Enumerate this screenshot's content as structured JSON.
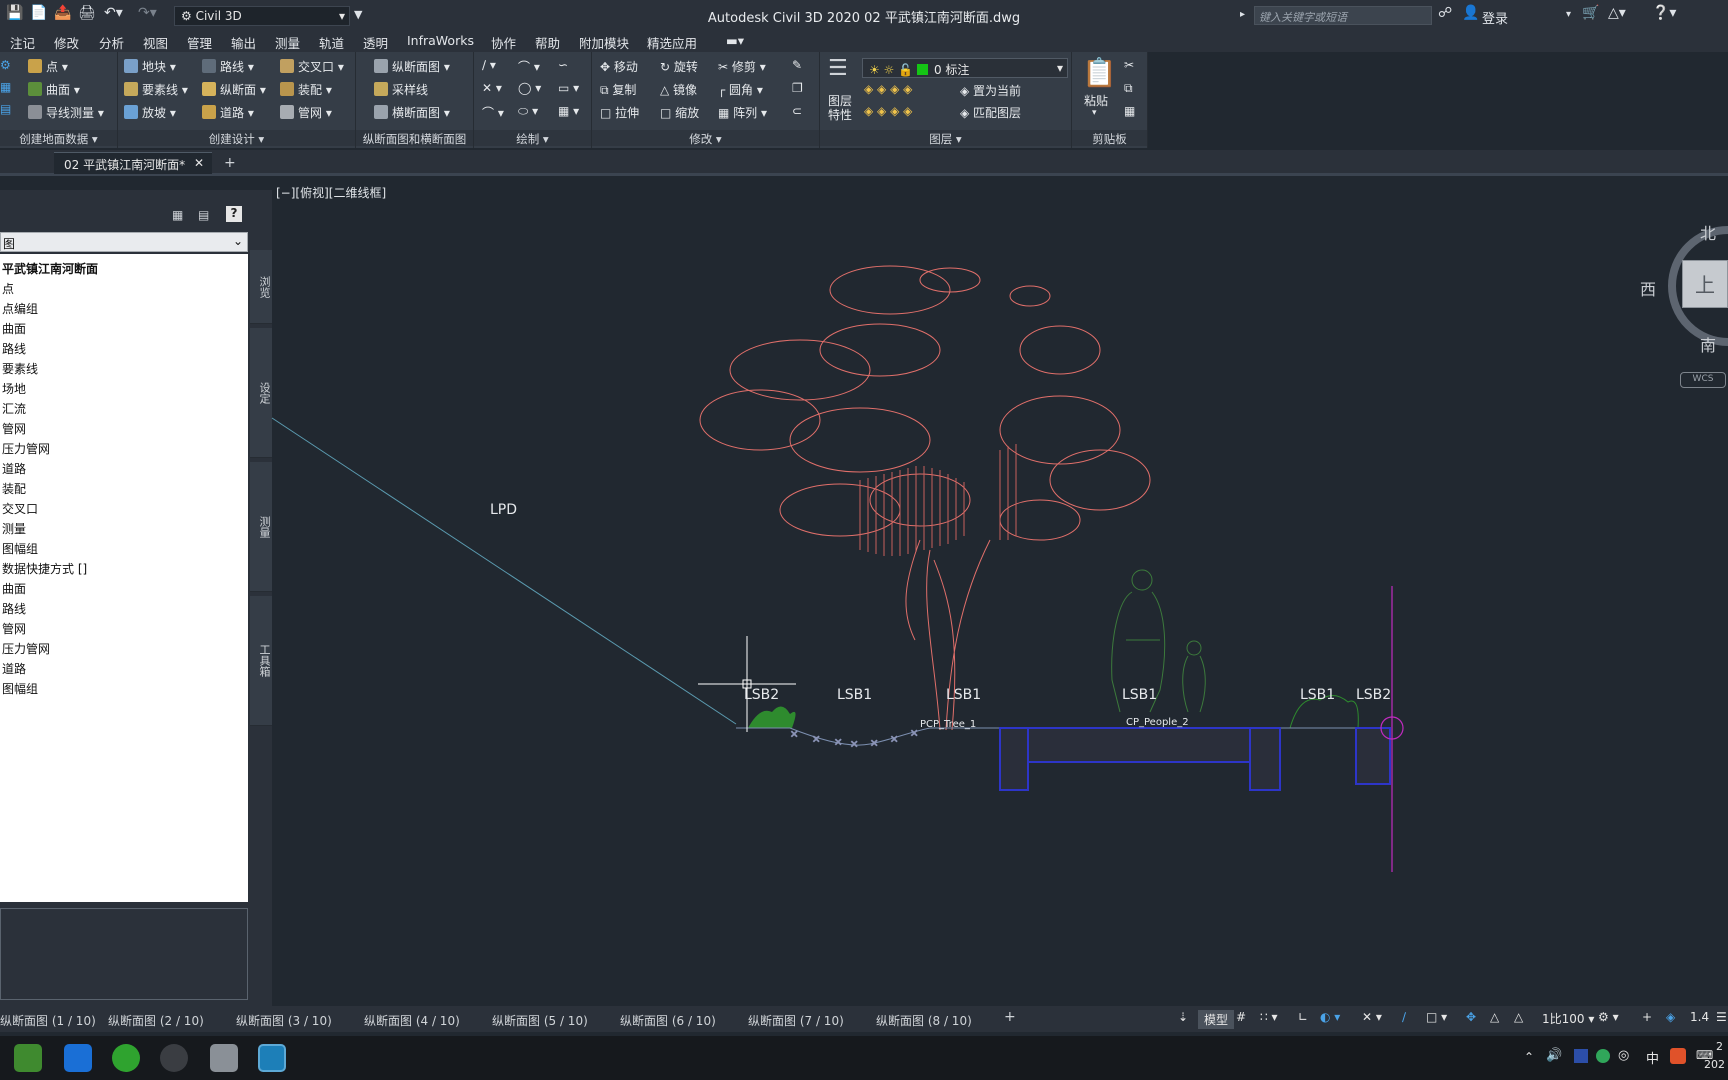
{
  "title_bar": {
    "app_title": "Autodesk Civil 3D 2020    02 平武镇江南河断面.dwg",
    "workspace": "Civil 3D",
    "search_placeholder": "键入关键字或短语",
    "login": "登录"
  },
  "menu": [
    "注记",
    "修改",
    "分析",
    "视图",
    "管理",
    "输出",
    "测量",
    "轨道",
    "透明",
    "InfraWorks",
    "协作",
    "帮助",
    "附加模块",
    "精选应用"
  ],
  "ribbon": {
    "create_ground": {
      "title": "创建地面数据",
      "buttons": [
        "点",
        "曲面",
        "导线测量"
      ]
    },
    "create_design": {
      "title": "创建设计",
      "buttons": [
        "地块",
        "要素线",
        "放坡",
        "路线",
        "纵断面",
        "道路",
        "交叉口",
        "装配",
        "管网"
      ]
    },
    "profile_section": {
      "title": "纵断面图和横断面图",
      "buttons": [
        "纵断面图",
        "采样线",
        "横断面图"
      ]
    },
    "draw": {
      "title": "绘制"
    },
    "modify": {
      "title": "修改",
      "buttons": [
        "移动",
        "旋转",
        "修剪",
        "复制",
        "镜像",
        "圆角",
        "拉伸",
        "缩放",
        "阵列"
      ]
    },
    "layers": {
      "title": "图层",
      "current_layer": "0 标注",
      "properties_label": "图层特性",
      "set_current": "置为当前",
      "match_layer": "匹配图层"
    },
    "clipboard": {
      "title": "剪贴板",
      "paste": "粘贴"
    }
  },
  "document_tab": "02 平武镇江南河断面*",
  "viewport": {
    "label": "[−][俯视][二维线框]",
    "viewcube": {
      "north": "北",
      "south": "南",
      "west": "西",
      "top": "上",
      "wcs": "WCS"
    },
    "labels": [
      "LPD",
      "LSB2",
      "LSB1",
      "LSB1",
      "LSB1",
      "LSB1",
      "LSB2"
    ],
    "small_labels": [
      "PCP_Tree_1",
      "CP_People_2"
    ],
    "colors": {
      "background": "#212830",
      "tree": "#e06f6a",
      "grass": "#2e8b2e",
      "people": "#3c7a3c",
      "slope_line": "#5b9bb0",
      "structure": "#2d35c8",
      "axis": "#c02bc0"
    }
  },
  "palette": {
    "dropdown": "图",
    "tree": [
      "平武镇江南河断面",
      "点",
      "点编组",
      "曲面",
      "路线",
      "要素线",
      "场地",
      "汇流",
      "管网",
      "压力管网",
      "道路",
      "装配",
      "交叉口",
      "测量",
      "图幅组",
      "数据快捷方式 []",
      "曲面",
      "路线",
      "管网",
      "压力管网",
      "道路",
      "图幅组"
    ],
    "vertical_tabs": [
      "浏览",
      "设定",
      "测量",
      "工具箱"
    ]
  },
  "layout_tabs": [
    "纵断面图 (1 / 10)",
    "纵断面图 (2 / 10)",
    "纵断面图 (3 / 10)",
    "纵断面图 (4 / 10)",
    "纵断面图 (5 / 10)",
    "纵断面图 (6 / 10)",
    "纵断面图 (7 / 10)",
    "纵断面图 (8 / 10)"
  ],
  "status_bar": {
    "model": "模型",
    "scale": "1比100",
    "value": "1.4"
  },
  "taskbar": {
    "ime": "中",
    "clock_partial": "2",
    "date_partial": "202"
  }
}
